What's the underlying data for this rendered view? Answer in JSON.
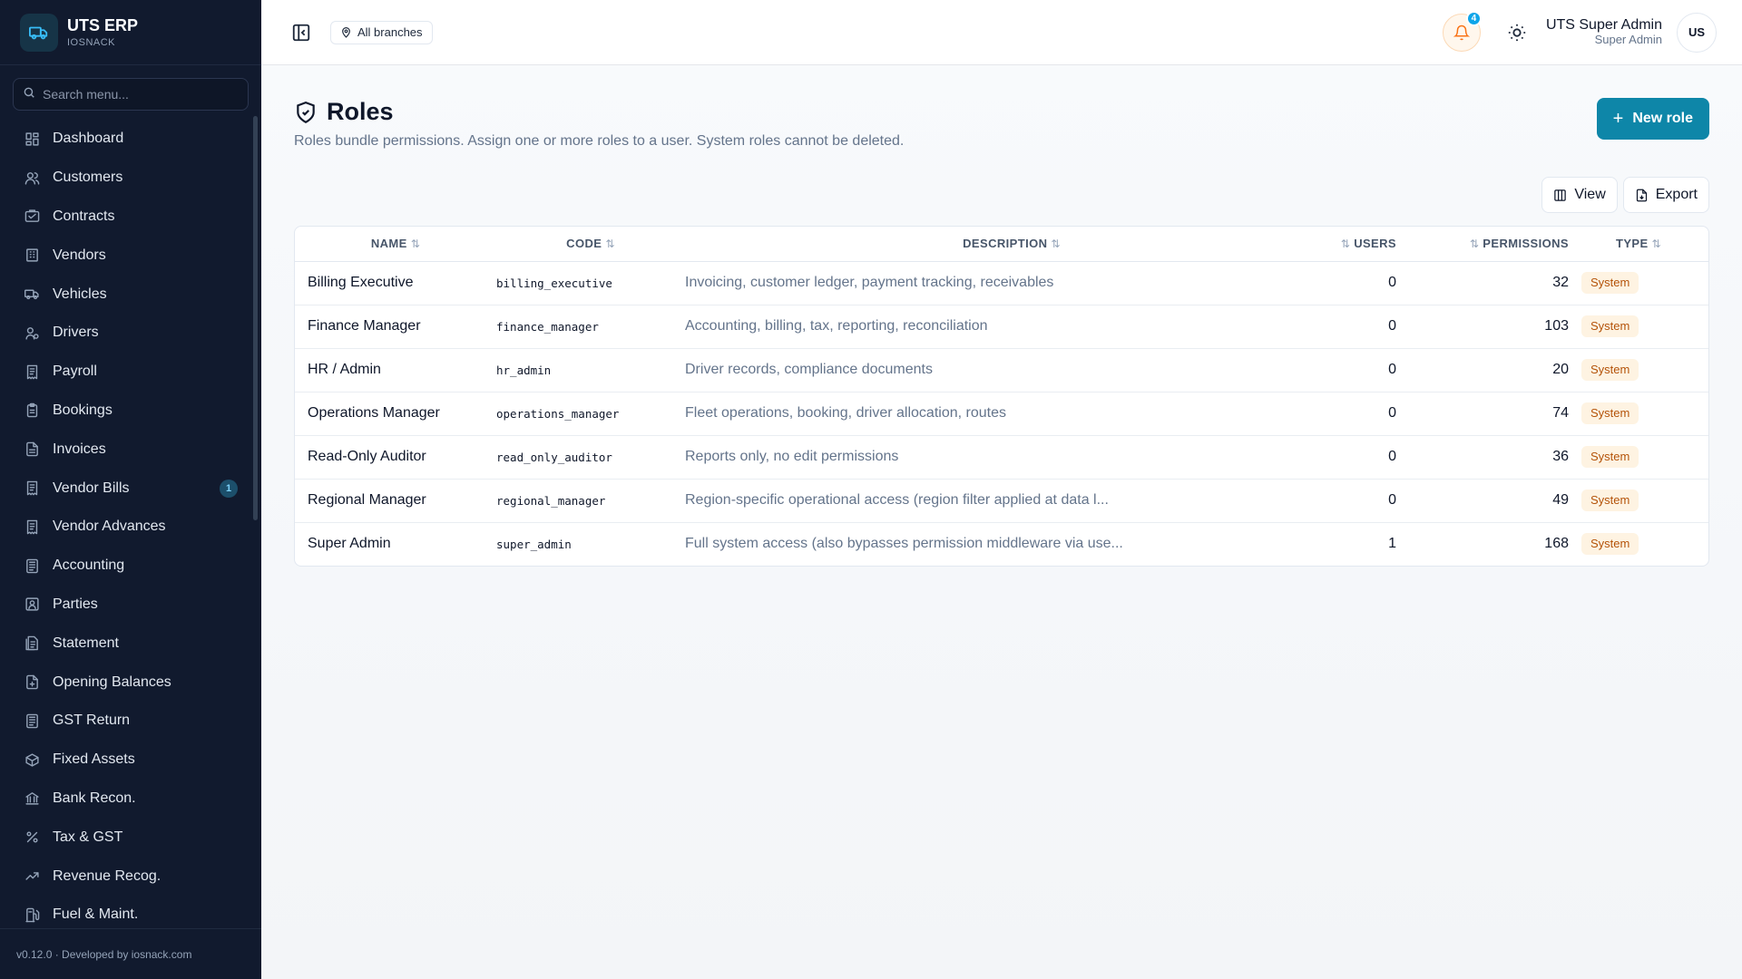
{
  "brand": {
    "name": "UTS ERP",
    "sub": "IOSNACK"
  },
  "search": {
    "placeholder": "Search menu..."
  },
  "sidebar": {
    "items": [
      {
        "label": "Dashboard",
        "icon": "dashboard-icon"
      },
      {
        "label": "Customers",
        "icon": "users-icon"
      },
      {
        "label": "Contracts",
        "icon": "contract-icon"
      },
      {
        "label": "Vendors",
        "icon": "building-icon"
      },
      {
        "label": "Vehicles",
        "icon": "truck-icon"
      },
      {
        "label": "Drivers",
        "icon": "driver-icon"
      },
      {
        "label": "Payroll",
        "icon": "receipt-icon"
      },
      {
        "label": "Bookings",
        "icon": "clipboard-icon"
      },
      {
        "label": "Invoices",
        "icon": "file-icon"
      },
      {
        "label": "Vendor Bills",
        "icon": "receipt-icon",
        "badge": "1"
      },
      {
        "label": "Vendor Advances",
        "icon": "receipt-icon"
      },
      {
        "label": "Accounting",
        "icon": "ledger-icon"
      },
      {
        "label": "Parties",
        "icon": "contact-icon"
      },
      {
        "label": "Statement",
        "icon": "statement-icon"
      },
      {
        "label": "Opening Balances",
        "icon": "file-plus-icon"
      },
      {
        "label": "GST Return",
        "icon": "ledger-icon"
      },
      {
        "label": "Fixed Assets",
        "icon": "box-icon"
      },
      {
        "label": "Bank Recon.",
        "icon": "bank-icon"
      },
      {
        "label": "Tax & GST",
        "icon": "percent-icon"
      },
      {
        "label": "Revenue Recog.",
        "icon": "trending-icon"
      },
      {
        "label": "Fuel & Maint.",
        "icon": "fuel-icon"
      }
    ],
    "footer": "v0.12.0 · Developed by iosnack.com"
  },
  "topbar": {
    "branch": "All branches",
    "notification_count": "4",
    "user_name": "UTS Super Admin",
    "user_role": "Super Admin",
    "avatar": "US"
  },
  "page": {
    "title": "Roles",
    "subtitle": "Roles bundle permissions. Assign one or more roles to a user. System roles cannot be deleted.",
    "new_button": "New role",
    "view_button": "View",
    "export_button": "Export"
  },
  "table": {
    "headers": {
      "name": "NAME",
      "code": "CODE",
      "description": "DESCRIPTION",
      "users": "USERS",
      "permissions": "PERMISSIONS",
      "type": "TYPE"
    },
    "rows": [
      {
        "name": "Billing Executive",
        "code": "billing_executive",
        "description": "Invoicing, customer ledger, payment tracking, receivables",
        "users": "0",
        "permissions": "32",
        "type": "System"
      },
      {
        "name": "Finance Manager",
        "code": "finance_manager",
        "description": "Accounting, billing, tax, reporting, reconciliation",
        "users": "0",
        "permissions": "103",
        "type": "System"
      },
      {
        "name": "HR / Admin",
        "code": "hr_admin",
        "description": "Driver records, compliance documents",
        "users": "0",
        "permissions": "20",
        "type": "System"
      },
      {
        "name": "Operations Manager",
        "code": "operations_manager",
        "description": "Fleet operations, booking, driver allocation, routes",
        "users": "0",
        "permissions": "74",
        "type": "System"
      },
      {
        "name": "Read-Only Auditor",
        "code": "read_only_auditor",
        "description": "Reports only, no edit permissions",
        "users": "0",
        "permissions": "36",
        "type": "System"
      },
      {
        "name": "Regional Manager",
        "code": "regional_manager",
        "description": "Region-specific operational access (region filter applied at data l...",
        "users": "0",
        "permissions": "49",
        "type": "System"
      },
      {
        "name": "Super Admin",
        "code": "super_admin",
        "description": "Full system access (also bypasses permission middleware via use...",
        "users": "1",
        "permissions": "168",
        "type": "System"
      }
    ]
  },
  "colors": {
    "sidebar_bg": "#111a2e",
    "accent": "#0e86a8",
    "badge_bg": "#fef3e2",
    "badge_text": "#b45309",
    "bell": "#f97316"
  }
}
